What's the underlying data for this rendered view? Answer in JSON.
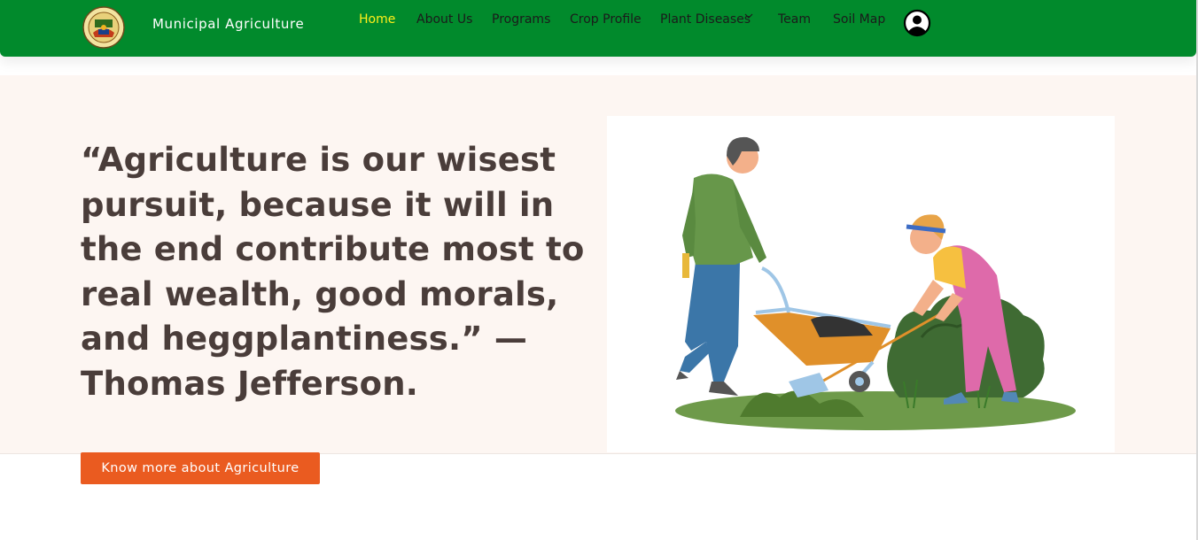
{
  "navbar": {
    "brand": "Municipal Agriculture",
    "links": [
      {
        "label": "Home",
        "active": true
      },
      {
        "label": "About Us"
      },
      {
        "label": "Programs"
      },
      {
        "label": "Crop Profile"
      },
      {
        "label": "Plant Diseases",
        "has_dropdown": true
      },
      {
        "label": "Team"
      },
      {
        "label": "Soil Map"
      }
    ],
    "logo_icon": "municipal-seal-icon",
    "account_icon": "user-circle-icon"
  },
  "hero": {
    "quote": "“Agriculture is our wisest pursuit, because it will in the end contribute most to real wealth, good morals, and heggplantiness.” — Thomas Jefferson.",
    "cta_label": "Know more about Agriculture",
    "illustration": "farmers-wheelbarrow-illustration"
  },
  "colors": {
    "nav_bg": "#018a2c",
    "nav_active": "#ffef1a",
    "hero_bg": "#fdf6f2",
    "quote_text": "#4a3d3a",
    "cta_bg": "#ea5b20"
  }
}
